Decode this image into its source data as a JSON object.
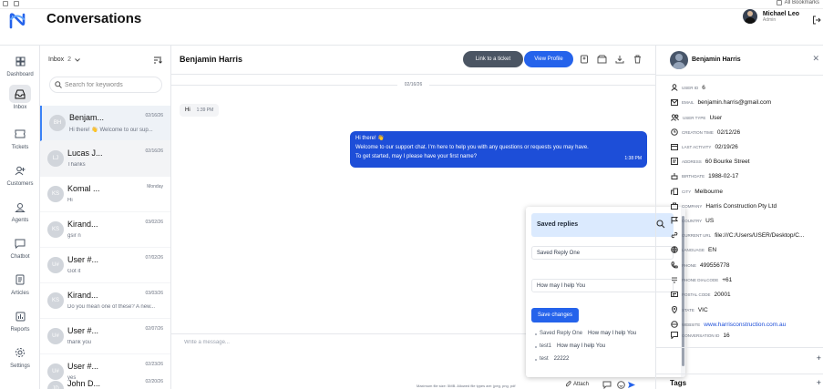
{
  "browser": {
    "bookmarks_label": "All Bookmarks"
  },
  "header": {
    "title": "Conversations",
    "user_name": "Michael Leo",
    "user_role": "Admin"
  },
  "sidebar": {
    "items": [
      {
        "label": "Dashboard",
        "icon": "dashboard-icon"
      },
      {
        "label": "Inbox",
        "icon": "inbox-icon",
        "active": true
      },
      {
        "label": "Tickets",
        "icon": "ticket-icon"
      },
      {
        "label": "Customers",
        "icon": "customers-icon"
      },
      {
        "label": "Agents",
        "icon": "agents-icon"
      },
      {
        "label": "Chatbot",
        "icon": "chatbot-icon"
      },
      {
        "label": "Articles",
        "icon": "articles-icon"
      },
      {
        "label": "Reports",
        "icon": "reports-icon"
      },
      {
        "label": "Settings",
        "icon": "settings-icon"
      }
    ]
  },
  "list": {
    "filter_label": "Inbox",
    "filter_count": "2",
    "search_placeholder": "Search for keywords",
    "conversations": [
      {
        "initials": "BH",
        "name": "Benjam...",
        "date": "02/16/26",
        "preview": "Hi there! 👋 Welcome to our sup..."
      },
      {
        "initials": "LJ",
        "name": "Lucas J...",
        "date": "02/16/26",
        "preview": "Thanks"
      },
      {
        "initials": "KS",
        "name": "Komal ...",
        "date": "Monday",
        "preview": "Hi"
      },
      {
        "initials": "KS",
        "name": "Kirand...",
        "date": "03/02/26",
        "preview": "gsir n"
      },
      {
        "initials": "U#",
        "name": "User #...",
        "date": "07/02/26",
        "preview": "Got it"
      },
      {
        "initials": "KS",
        "name": "Kirand...",
        "date": "03/03/26",
        "preview": "Do you mean one of these? A new..."
      },
      {
        "initials": "U#",
        "name": "User #...",
        "date": "02/07/26",
        "preview": "thank you"
      },
      {
        "initials": "U#",
        "name": "User #...",
        "date": "02/23/26",
        "preview": "yes"
      },
      {
        "initials": "JD",
        "name": "John D...",
        "date": "02/20/26",
        "preview": ""
      }
    ]
  },
  "chat": {
    "name": "Benjamin Harris",
    "link_ticket_label": "Link to a ticket",
    "view_profile_label": "View Profile",
    "date_separator": "02/16/26",
    "incoming": {
      "text": "Hi",
      "time": "1:39 PM"
    },
    "outgoing": {
      "line1": "Hi there! 👋",
      "line2": "Welcome to our support chat. I'm here to help you with any questions or requests you may have.",
      "line3": "To get started, may I please have your first name?",
      "time": "1:38 PM"
    },
    "composer_placeholder": "Write a message...",
    "file_hint": "Maximum file size: 5MB. Allowed file types are: jpeg, png, pdf",
    "attach_label": "Attach"
  },
  "saved_replies": {
    "title": "Saved replies",
    "field1": "Saved Reply One",
    "field2": "How may I help You",
    "save_label": "Save changes",
    "items": [
      {
        "key": "Saved Reply One",
        "value": "How may I help You"
      },
      {
        "key": "test1",
        "value": "How may I help You"
      },
      {
        "key": "test",
        "value": "22222"
      }
    ]
  },
  "profile": {
    "name": "Benjamin Harris",
    "fields": [
      {
        "label": "User ID",
        "value": "6",
        "icon": "user-icon"
      },
      {
        "label": "Email",
        "value": "benjamin.harris@gmail.com",
        "icon": "mail-icon"
      },
      {
        "label": "User Type",
        "value": "User",
        "icon": "users-icon"
      },
      {
        "label": "Creation Time",
        "value": "02/12/26",
        "icon": "clock-icon"
      },
      {
        "label": "Last Activity",
        "value": "02/19/26",
        "icon": "calendar-icon"
      },
      {
        "label": "Address",
        "value": "60 Bourke Street",
        "icon": "address-icon"
      },
      {
        "label": "Birthdate",
        "value": "1988-02-17",
        "icon": "cake-icon"
      },
      {
        "label": "City",
        "value": "Melbourne",
        "icon": "city-icon"
      },
      {
        "label": "Company",
        "value": "Harris Construction Pty Ltd",
        "icon": "company-icon"
      },
      {
        "label": "Country",
        "value": "US",
        "icon": "flag-icon"
      },
      {
        "label": "Current URL",
        "value": "file:///C:/Users/USER/Desktop/C...",
        "icon": "link-icon"
      },
      {
        "label": "Language",
        "value": "EN",
        "icon": "language-icon"
      },
      {
        "label": "Phone",
        "value": "499556778",
        "icon": "phone-icon"
      },
      {
        "label": "Phone Dialcode",
        "value": "+61",
        "icon": "dial-icon"
      },
      {
        "label": "Postal Code",
        "value": "20001",
        "icon": "postal-icon"
      },
      {
        "label": "State",
        "value": "VIC",
        "icon": "state-icon"
      },
      {
        "label": "Website",
        "value": "www.harrisconstruction.com.au",
        "icon": "web-icon"
      },
      {
        "label": "Conversation ID",
        "value": "16",
        "icon": "chat-icon"
      }
    ],
    "tags_label": "Tags"
  },
  "colors": {
    "accent": "#2563eb",
    "dark_button": "#4b5563",
    "outgoing_bubble": "#1d4ed8",
    "popup_header": "#dbeafe"
  }
}
